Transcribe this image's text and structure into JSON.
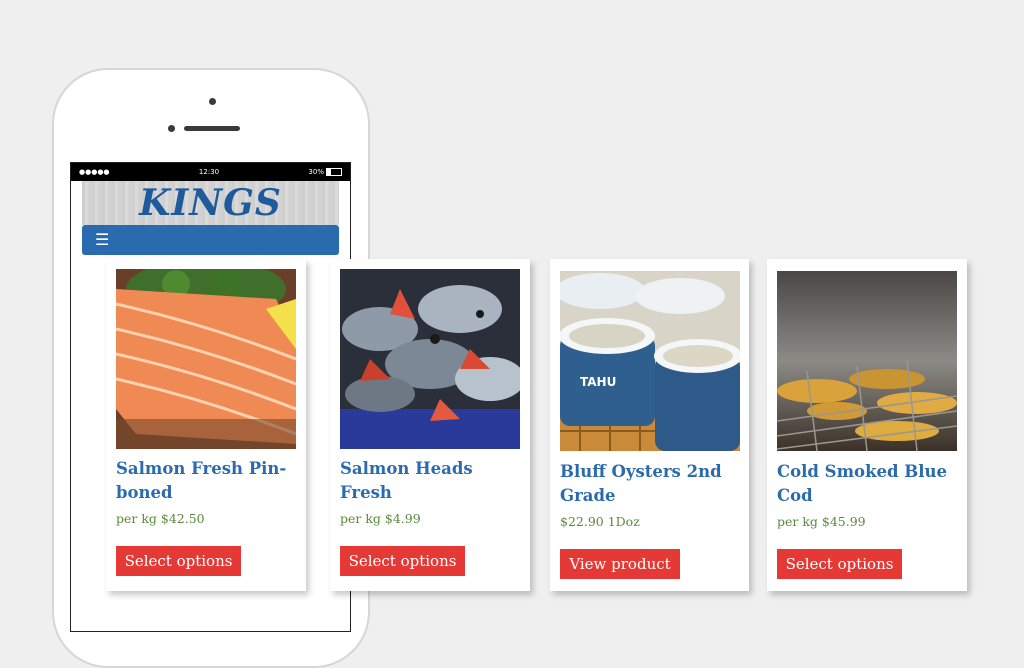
{
  "status_bar": {
    "signal": "●●●●●",
    "time": "12:30",
    "battery": "30%"
  },
  "header": {
    "logo": "KINGS",
    "menu_icon": "☰"
  },
  "products": [
    {
      "title": "Salmon Fresh Pin-boned",
      "price": "per kg $42.50",
      "button": "Select options",
      "image": "salmon-fillet"
    },
    {
      "title": "Salmon Heads Fresh",
      "price": "per kg $4.99",
      "button": "Select options",
      "image": "salmon-heads"
    },
    {
      "title": "Bluff Oysters 2nd Grade",
      "price": "$22.90 1Doz",
      "button": "View product",
      "image": "oyster-tubs"
    },
    {
      "title": "Cold Smoked Blue Cod",
      "price": "per kg $45.99",
      "button": "Select options",
      "image": "smoked-cod"
    }
  ],
  "colors": {
    "brand_blue": "#2a6aaf",
    "button_red": "#e53935",
    "price_green": "#5a8a3a"
  }
}
